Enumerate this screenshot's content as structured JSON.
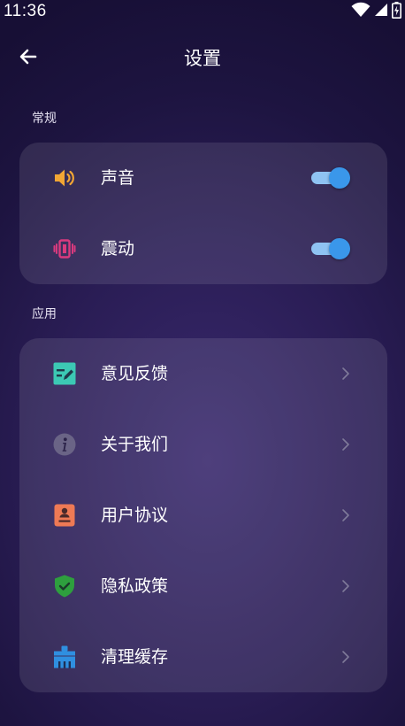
{
  "status_bar": {
    "time": "11:36",
    "icons": [
      "wifi-icon",
      "cellular-signal-icon",
      "battery-icon"
    ]
  },
  "app_bar": {
    "title": "设置",
    "back_icon": "arrow-left-icon"
  },
  "sections": {
    "general": {
      "label": "常规",
      "items": [
        {
          "label": "声音",
          "icon": "speaker-icon",
          "color": "#f2a634",
          "toggle": true
        },
        {
          "label": "震动",
          "icon": "vibration-icon",
          "color": "#d93a7e",
          "toggle": true
        }
      ]
    },
    "app": {
      "label": "应用",
      "items": [
        {
          "label": "意见反馈",
          "icon": "feedback-edit-icon",
          "color": "#3cc9b4"
        },
        {
          "label": "关于我们",
          "icon": "info-icon",
          "color": "#6a6486"
        },
        {
          "label": "用户协议",
          "icon": "user-agreement-icon",
          "color": "#ee7a55"
        },
        {
          "label": "隐私政策",
          "icon": "shield-check-icon",
          "color": "#2e9f3e"
        },
        {
          "label": "清理缓存",
          "icon": "broom-clean-icon",
          "color": "#2f8fe0"
        }
      ]
    }
  },
  "colors": {
    "toggle_track": "#8fc3f2",
    "toggle_thumb": "#3a97ea",
    "background": "#241a4e"
  }
}
